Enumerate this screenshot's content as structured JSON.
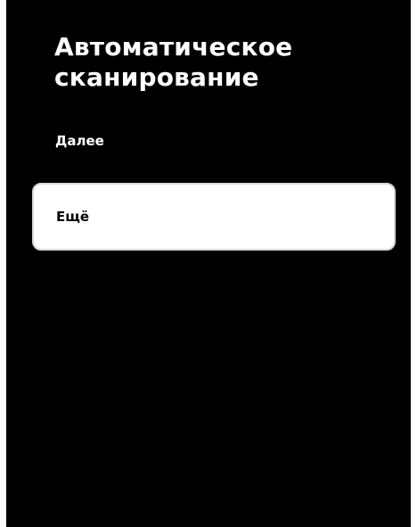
{
  "screen": {
    "title": "Автоматическое сканирование",
    "background_color": "#000000"
  },
  "menu": {
    "items": [
      {
        "label": "Далее",
        "selected": false
      },
      {
        "label": "Ещё",
        "selected": true
      }
    ],
    "selected_bg_color": "#ffffff",
    "text_color": "#ffffff",
    "selected_text_color": "#000000"
  }
}
